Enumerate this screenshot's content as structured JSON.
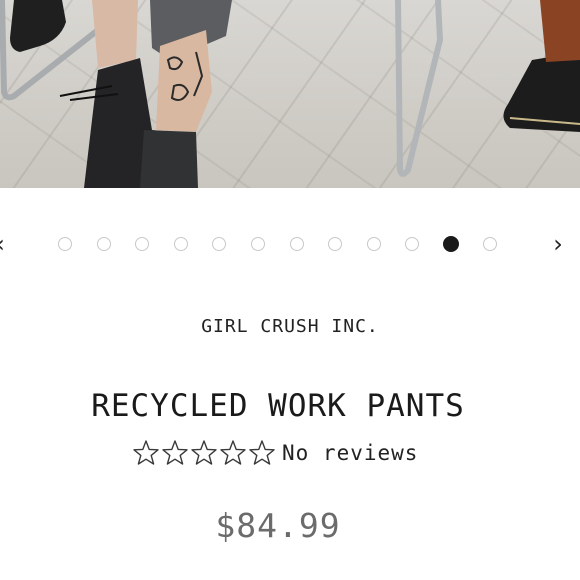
{
  "product_image": {
    "alt": "Person wearing recycled work pants and black boots seated on chairs"
  },
  "carousel": {
    "prev_icon": "chevron-left-icon",
    "next_icon": "chevron-right-icon",
    "prev_glyph": "‹",
    "next_glyph": "›",
    "slide_count": 12,
    "active_index": 10
  },
  "product": {
    "brand": "GIRL CRUSH INC.",
    "title": "RECYCLED WORK PANTS",
    "rating": {
      "stars": 0,
      "max": 5,
      "label": "No reviews"
    },
    "price": "$84.99"
  },
  "colors": {
    "active_dot": "#1a1a1a",
    "inactive_dot_border": "#c9c9c9",
    "price": "#6b6b6b"
  }
}
